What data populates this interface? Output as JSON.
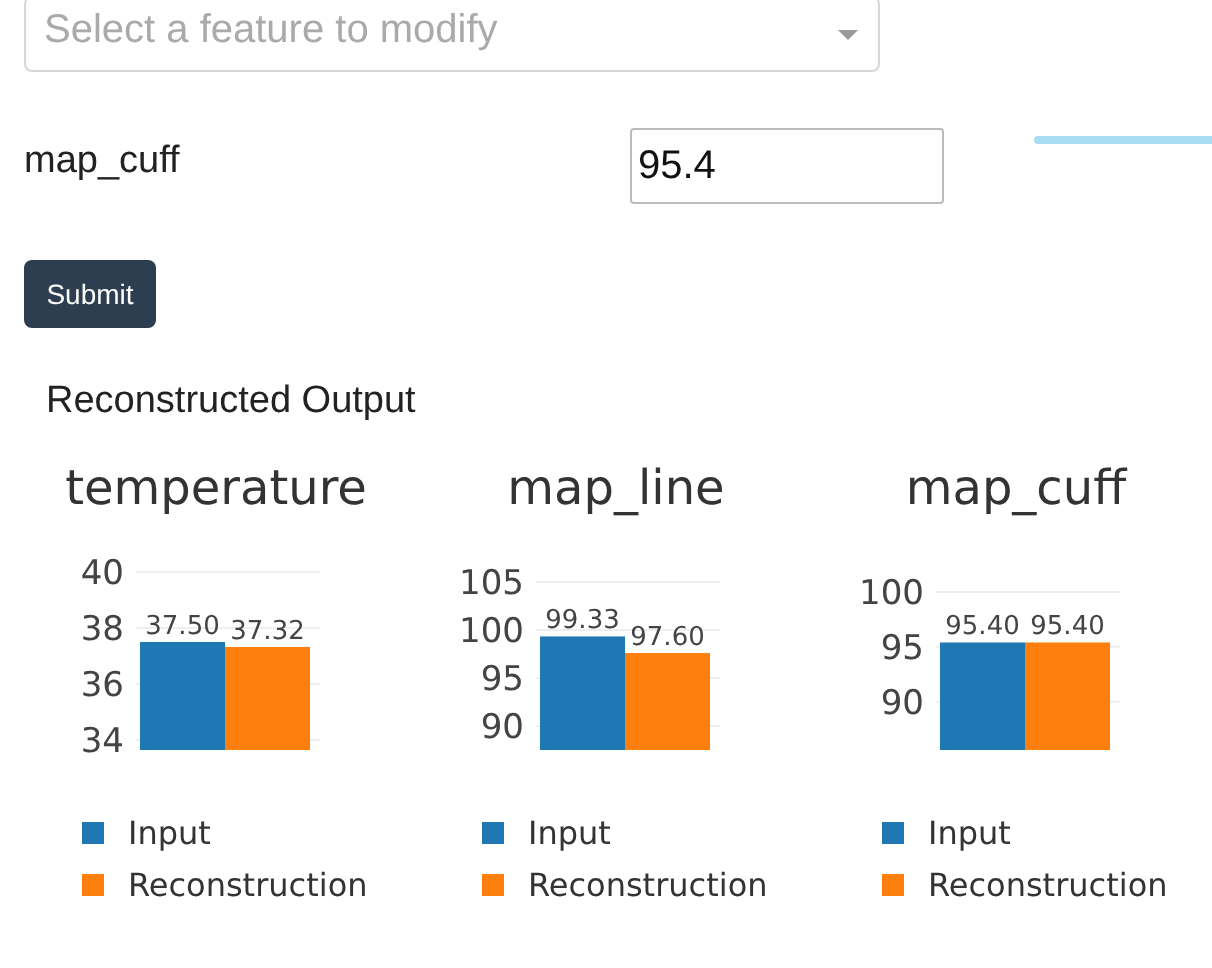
{
  "feature_select": {
    "placeholder": "Select a feature to modify"
  },
  "feature_input": {
    "label": "map_cuff",
    "value": "95.4"
  },
  "submit_button": {
    "label": "Submit"
  },
  "output": {
    "heading": "Reconstructed Output",
    "charts": [
      {
        "chart_data": {
          "type": "bar",
          "title": "temperature",
          "grid": true,
          "ylim": [
            33.64,
            40
          ],
          "yticks": [
            34,
            36,
            38,
            40
          ],
          "value_labels": [
            "37.50",
            "37.32"
          ],
          "series": [
            {
              "name": "Input",
              "color": "#1f77b4",
              "values": [
                37.5
              ]
            },
            {
              "name": "Reconstruction",
              "color": "#ff7f0e",
              "values": [
                37.32
              ]
            }
          ]
        }
      },
      {
        "chart_data": {
          "type": "bar",
          "title": "map_line",
          "grid": true,
          "ylim": [
            87.5,
            105
          ],
          "yticks": [
            90,
            95,
            100,
            105
          ],
          "value_labels": [
            "99.33",
            "97.60"
          ],
          "series": [
            {
              "name": "Input",
              "color": "#1f77b4",
              "values": [
                99.33
              ]
            },
            {
              "name": "Reconstruction",
              "color": "#ff7f0e",
              "values": [
                97.6
              ]
            }
          ]
        }
      },
      {
        "chart_data": {
          "type": "bar",
          "title": "map_cuff",
          "grid": true,
          "ylim": [
            85.6,
            100
          ],
          "yticks": [
            90,
            95,
            100
          ],
          "value_labels": [
            "95.40",
            "95.40"
          ],
          "series": [
            {
              "name": "Input",
              "color": "#1f77b4",
              "values": [
                95.4
              ]
            },
            {
              "name": "Reconstruction",
              "color": "#ff7f0e",
              "values": [
                95.4
              ]
            }
          ]
        }
      }
    ]
  }
}
